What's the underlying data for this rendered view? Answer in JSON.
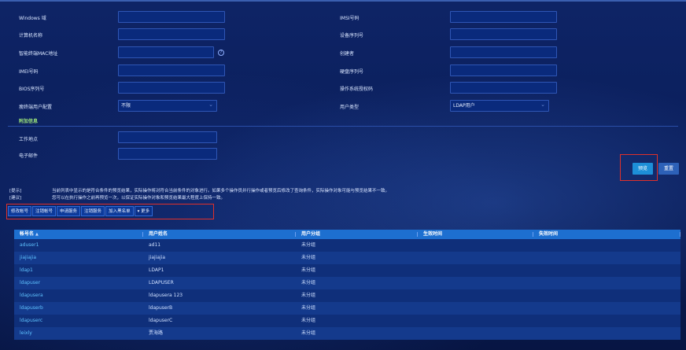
{
  "form": {
    "left_fields": [
      {
        "label": "Windows 域",
        "value": ""
      },
      {
        "label": "计算机名称",
        "value": ""
      },
      {
        "label": "智能终端MAC地址",
        "value": ""
      },
      {
        "label": "IMEI号码",
        "value": ""
      },
      {
        "label": "BIOS序列号",
        "value": ""
      },
      {
        "label": "瘦终端用户配置",
        "value": "不限"
      }
    ],
    "right_fields": [
      {
        "label": "IMSI号码",
        "value": ""
      },
      {
        "label": "设备序列号",
        "value": ""
      },
      {
        "label": "创建者",
        "value": ""
      },
      {
        "label": "硬盘序列号",
        "value": ""
      },
      {
        "label": "操作系统授权码",
        "value": ""
      },
      {
        "label": "用户类型",
        "value": "LDAP用户"
      }
    ],
    "help_glyph": "?",
    "extra_section_title": "附加信息",
    "extra_fields": [
      {
        "label": "工作地点",
        "value": ""
      },
      {
        "label": "电子邮件",
        "value": ""
      }
    ],
    "preview_label": "预览",
    "reset_label": "重置"
  },
  "notes": {
    "tip_tag": "[提示]",
    "tip_text": "当前列表中显示的是符合条件的预览结果，实际操作将对符合当前条件的对象进行。如果多个操作员并行操作或者预览后修改了查询条件，实际操作对象可能与预览结果不一致。",
    "suggest_tag": "[建议]",
    "suggest_text": "您可以在执行操作之前再预览一次，以保证实际操作对象和预览结果最大程度上保持一致。"
  },
  "actions": [
    "修改帐号",
    "注销帐号",
    "申请服务",
    "注销服务",
    "加入黑名单"
  ],
  "more_label": "更多",
  "more_icon": "chevron-down-icon",
  "table": {
    "headers": [
      "帐号名",
      "用户姓名",
      "用户分组",
      "生效时间",
      "失效时间"
    ],
    "sort_glyph": "▲",
    "rows": [
      {
        "account": "aduser1",
        "name": "ad11",
        "group": "未分组",
        "start": "",
        "end": ""
      },
      {
        "account": "jiajiajia",
        "name": "jiajiajia",
        "group": "未分组",
        "start": "",
        "end": ""
      },
      {
        "account": "ldap1",
        "name": "LDAP1",
        "group": "未分组",
        "start": "",
        "end": ""
      },
      {
        "account": "ldapuser",
        "name": "LDAPUSER",
        "group": "未分组",
        "start": "",
        "end": ""
      },
      {
        "account": "ldapusera",
        "name": "ldapusera 123",
        "group": "未分组",
        "start": "",
        "end": ""
      },
      {
        "account": "ldapuserb",
        "name": "ldapuserB",
        "group": "未分组",
        "start": "",
        "end": ""
      },
      {
        "account": "ldapuserc",
        "name": "ldapuserC",
        "group": "未分组",
        "start": "",
        "end": ""
      },
      {
        "account": "leixly",
        "name": "贾海路",
        "group": "未分组",
        "start": "",
        "end": ""
      }
    ]
  },
  "colors": {
    "accent": "#1d8fd8",
    "highlight_box": "#e0302a",
    "section_title": "#9be37a",
    "link": "#5fc3ff"
  }
}
